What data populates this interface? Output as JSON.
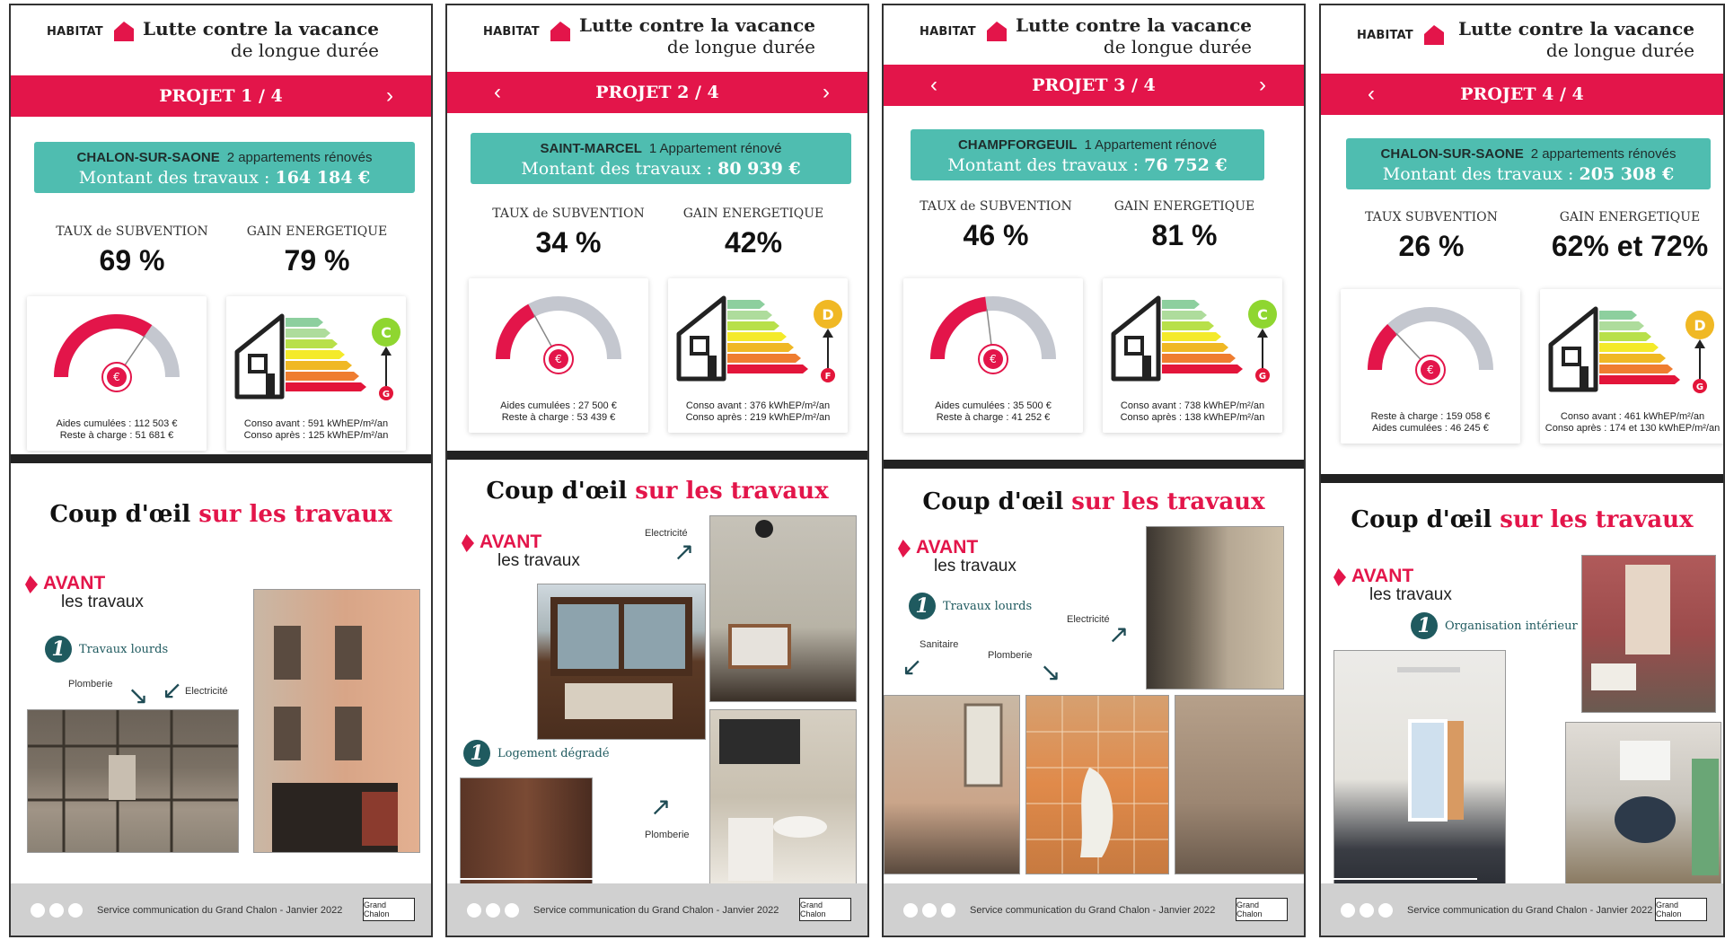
{
  "header": {
    "brand": "HABITAT",
    "title_line1": "Lutte contre la vacance",
    "title_line2": "de longue durée"
  },
  "common": {
    "coup_dark": "Coup d'œil",
    "coup_accent": "sur les travaux",
    "avant_label": "AVANT",
    "avant_sub": "les travaux",
    "footer_text": "Service communication du Grand Chalon - Janvier 2022",
    "footer_logo": "Grand Chalon",
    "nav_prev": "‹",
    "nav_next": "›"
  },
  "projects": [
    {
      "label": "PROJET 1 / 4",
      "city": "CHALON-SUR-SAONE",
      "units": "2 appartements  rénovés",
      "amount_label": "Montant des travaux :",
      "amount": "164 184 €",
      "stat1_label": "TAUX de SUBVENTION",
      "stat1_value": "69 %",
      "stat2_label": "GAIN ENERGETIQUE",
      "stat2_value": "79 %",
      "gauge_fraction": 0.69,
      "aid_line1": "Aides cumulées : 112 503 €",
      "aid_line2": "Reste à charge : 51 681 €",
      "conso_before": "Conso avant : 591 kWhEP/m²/an",
      "conso_after": "Conso après : 125 kWhEP/m²/an",
      "badge_after": "C",
      "badge_before": "G",
      "badge_color": "#8fd630",
      "work_label": "Travaux lourds",
      "notes": [
        "Plomberie",
        "Electricité"
      ]
    },
    {
      "label": "PROJET 2 / 4",
      "city": "SAINT-MARCEL",
      "units": "1 Appartement rénové",
      "amount_label": "Montant des travaux :",
      "amount": "80 939 €",
      "stat1_label": "TAUX de SUBVENTION",
      "stat1_value": "34 %",
      "stat2_label": "GAIN ENERGETIQUE",
      "stat2_value": "42%",
      "gauge_fraction": 0.34,
      "aid_line1": "Aides cumulées : 27 500 €",
      "aid_line2": "Reste à charge : 53 439 €",
      "conso_before": "Conso avant : 376 kWhEP/m²/an",
      "conso_after": "Conso après : 219 kWhEP/m²/an",
      "badge_after": "D",
      "badge_before": "F",
      "badge_color": "#f0b824",
      "work_label": "Logement dégradé",
      "notes": [
        "Electricité",
        "Plomberie"
      ]
    },
    {
      "label": "PROJET 3 / 4",
      "city": "CHAMPFORGEUIL",
      "units": "1 Appartement rénové",
      "amount_label": "Montant des travaux :",
      "amount": "76 752 €",
      "stat1_label": "TAUX de SUBVENTION",
      "stat1_value": "46 %",
      "stat2_label": "GAIN ENERGETIQUE",
      "stat2_value": "81 %",
      "gauge_fraction": 0.46,
      "aid_line1": "Aides cumulées : 35 500 €",
      "aid_line2": "Reste à charge : 41 252 €",
      "conso_before": "Conso avant : 738 kWhEP/m²/an",
      "conso_after": "Conso après : 138 kWhEP/m²/an",
      "badge_after": "C",
      "badge_before": "G",
      "badge_color": "#8fd630",
      "work_label": "Travaux lourds",
      "notes": [
        "Electricité",
        "Sanitaire",
        "Plomberie"
      ]
    },
    {
      "label": "PROJET 4 / 4",
      "city": "CHALON-SUR-SAONE",
      "units": "2 appartements  rénovés",
      "amount_label": "Montant des travaux :",
      "amount": "205 308 €",
      "stat1_label": "TAUX SUBVENTION",
      "stat1_value": "26 %",
      "stat2_label": "GAIN ENERGETIQUE",
      "stat2_value": "62% et 72%",
      "gauge_fraction": 0.26,
      "aid_line1": "Reste à charge : 159 058 €",
      "aid_line2": "Aides cumulées : 46 245 €",
      "conso_before": "Conso avant : 461 kWhEP/m²/an",
      "conso_after": "Conso après : 174 et 130  kWhEP/m²/an",
      "badge_after": "D",
      "badge_before": "G",
      "badge_color": "#f0b824",
      "work_label": "Organisation intérieur",
      "notes": []
    }
  ]
}
